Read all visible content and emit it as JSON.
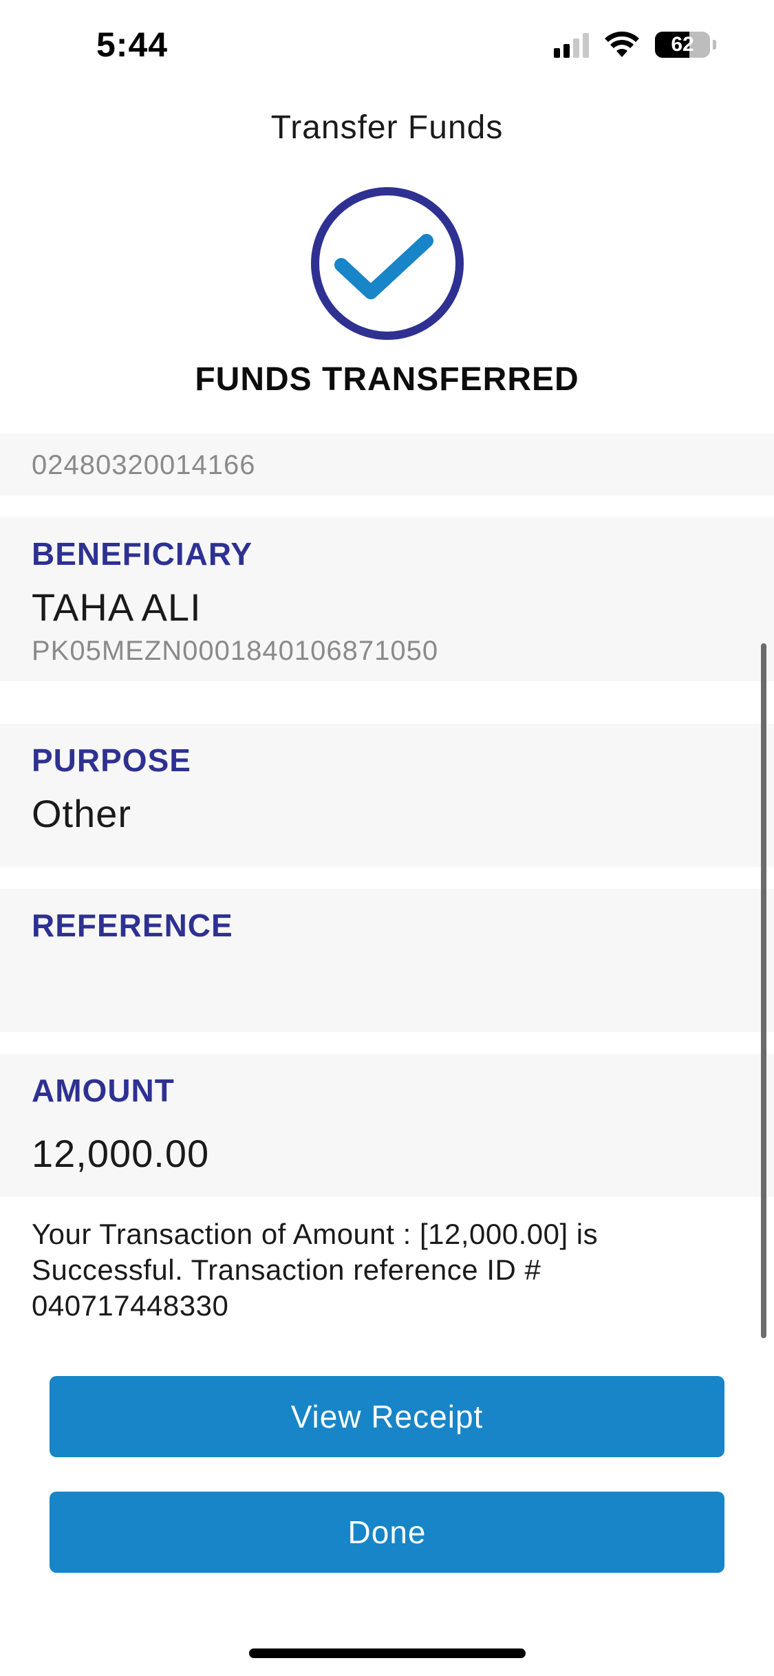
{
  "status_bar": {
    "time": "5:44",
    "battery_level": "62",
    "battery_fraction": 0.62,
    "icons": [
      "cellular-signal-icon",
      "wifi-icon",
      "battery-icon"
    ]
  },
  "header": {
    "title": "Transfer Funds"
  },
  "result": {
    "icon": "check-circle-icon",
    "heading": "FUNDS TRANSFERRED"
  },
  "details": {
    "from_account": "02480320014166",
    "beneficiary": {
      "label": "BENEFICIARY",
      "name": "TAHA ALI",
      "iban": "PK05MEZN0001840106871050"
    },
    "purpose": {
      "label": "PURPOSE",
      "value": "Other"
    },
    "reference": {
      "label": "REFERENCE",
      "value": ""
    },
    "amount": {
      "label": "AMOUNT",
      "value": "12,000.00"
    }
  },
  "message": "Your Transaction of Amount : [12,000.00] is Successful. Transaction reference ID # 040717448330",
  "actions": {
    "view_receipt": "View Receipt",
    "done": "Done"
  },
  "colors": {
    "accent_label": "#2e3192",
    "button": "#1785c7",
    "check_ring": "#2e3192",
    "check_mark": "#1785c7",
    "row_background": "#f7f7f7"
  }
}
